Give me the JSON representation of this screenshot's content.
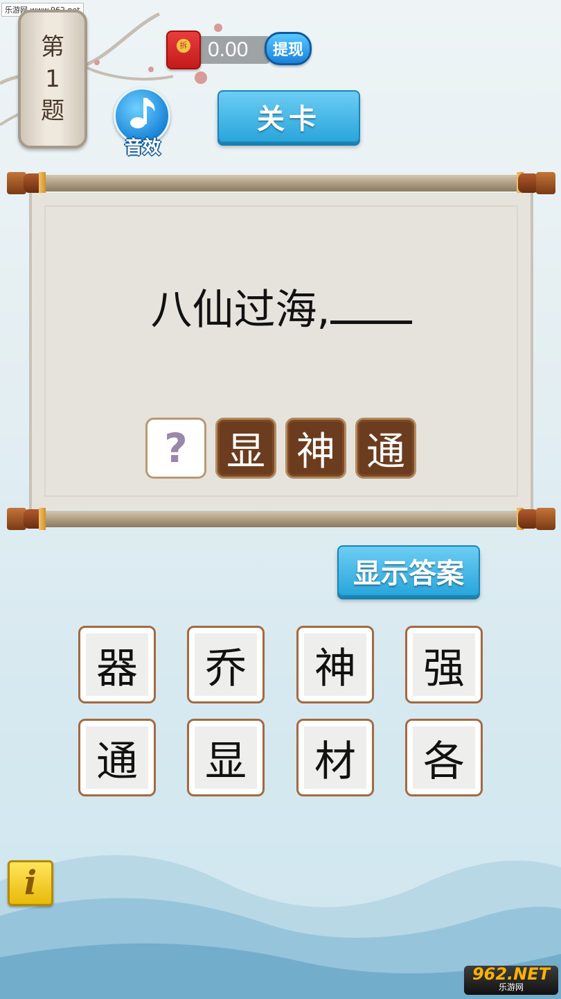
{
  "watermark": {
    "top": "乐游网 www.962.net",
    "bottom_logo": "962.NET",
    "bottom_sub": "乐游网"
  },
  "level_plaque": {
    "prefix": "第",
    "number": "1",
    "suffix": "题"
  },
  "wallet": {
    "amount": "0.00",
    "withdraw_label": "提现",
    "redpacket_seal": "拆"
  },
  "sound": {
    "label": "音效",
    "icon": "music-note-icon"
  },
  "level_button": {
    "label": "关卡"
  },
  "puzzle": {
    "question": "八仙过海,",
    "answer_slots": [
      "?",
      "显",
      "神",
      "通"
    ]
  },
  "show_answer": {
    "label": "显示答案"
  },
  "choices": [
    [
      "器",
      "乔",
      "神",
      "强"
    ],
    [
      "通",
      "显",
      "材",
      "各"
    ]
  ],
  "info": {
    "label": "i"
  },
  "colors": {
    "accent_blue": "#2aa5db",
    "slot_filled": "#6b3d1e",
    "tile_border": "#a36a42",
    "redpacket": "#c41a1a",
    "info_yellow": "#ffd21f"
  }
}
